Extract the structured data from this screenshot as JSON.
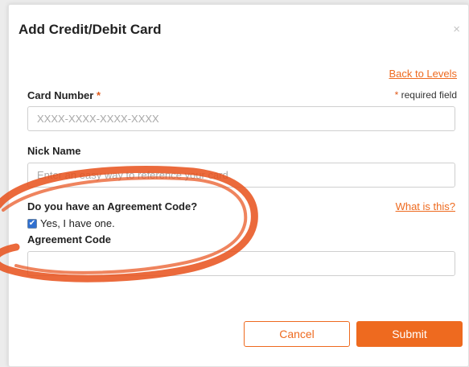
{
  "dialog": {
    "title": "Add Credit/Debit Card",
    "close_icon": "×"
  },
  "links": {
    "back_to_levels": "Back to Levels",
    "what_is_this": "What is this?"
  },
  "card_number": {
    "label": "Card Number",
    "required_star": "*",
    "placeholder": "XXXX-XXXX-XXXX-XXXX",
    "value": ""
  },
  "required_note": {
    "star": "*",
    "text": " required field"
  },
  "nick_name": {
    "label": "Nick Name",
    "placeholder": "Enter an easy way to reference your card",
    "value": ""
  },
  "agreement": {
    "question": "Do you have an Agreement Code?",
    "checkbox_checked": true,
    "checkbox_mark": "✔",
    "checkbox_label": "Yes, I have one.",
    "code_label": "Agreement Code",
    "code_value": ""
  },
  "buttons": {
    "cancel": "Cancel",
    "submit": "Submit"
  },
  "colors": {
    "accent": "#ee6a1f",
    "highlight_stroke": "#e8501a"
  }
}
